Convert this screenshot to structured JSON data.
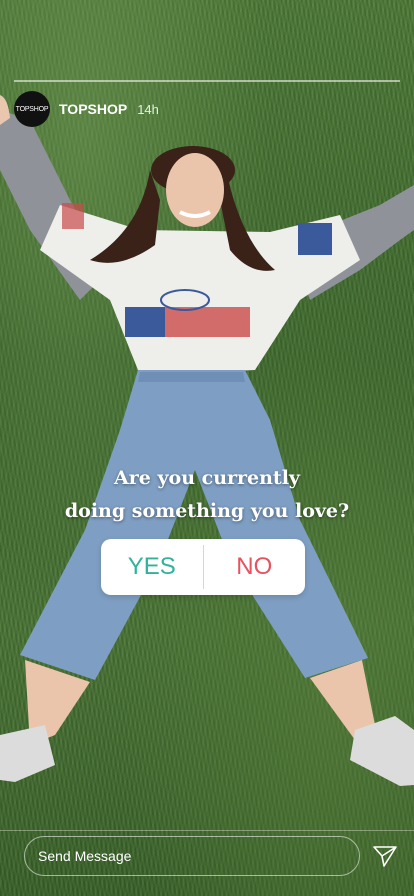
{
  "story": {
    "account_name": "TOPSHOP",
    "avatar_text": "TOPSHOP",
    "time_ago": "14h"
  },
  "poll": {
    "question_line1": "Are you currently",
    "question_line2": "doing something you love?",
    "yes_label": "YES",
    "no_label": "NO",
    "yes_color": "#2fb49a",
    "no_color": "#e8515e"
  },
  "footer": {
    "send_placeholder": "Send Message",
    "send_icon": "paper-plane-icon"
  }
}
